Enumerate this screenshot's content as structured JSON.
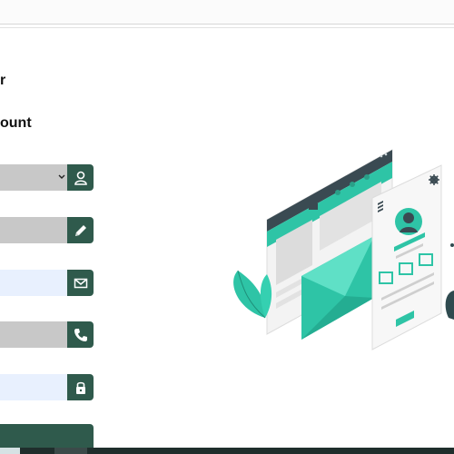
{
  "page": {
    "heading_line1": "r",
    "heading_line2": "ount"
  },
  "form": {
    "fields": [
      {
        "value": "",
        "icon": "user-icon"
      },
      {
        "value": "",
        "icon": "pencil-icon"
      },
      {
        "value": "",
        "icon": "envelope-icon"
      },
      {
        "value": "",
        "icon": "phone-icon"
      },
      {
        "value": "",
        "icon": "lock-icon"
      }
    ],
    "submit_label": ""
  },
  "colors": {
    "accent": "#2f5a4c",
    "illustration_teal": "#2ec4a6",
    "field_grey": "#c8c8c8",
    "field_blue": "#e8f0fe"
  }
}
